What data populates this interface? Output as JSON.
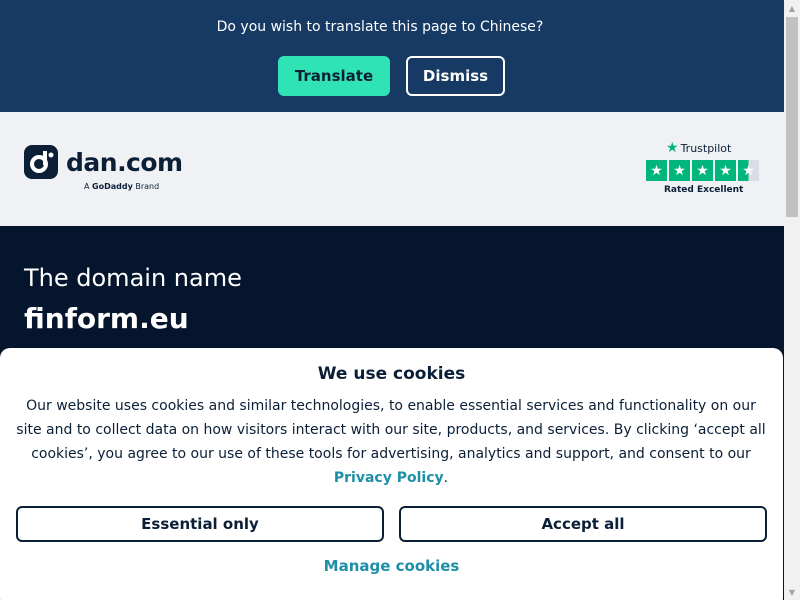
{
  "translate_bar": {
    "question": "Do you wish to translate this page to Chinese?",
    "translate_label": "Translate",
    "dismiss_label": "Dismiss"
  },
  "header": {
    "logo_text": "dan.com",
    "logo_sub_prefix": "A",
    "logo_sub_brand": "GoDaddy",
    "logo_sub_suffix": "Brand",
    "trustpilot": {
      "brand": "Trustpilot",
      "rating_text": "Rated Excellent",
      "stars": 4.5
    }
  },
  "hero": {
    "label": "The domain name",
    "domain": "finform.eu"
  },
  "cookie_dialog": {
    "title": "We use cookies",
    "body": "Our website uses cookies and similar technologies, to enable essential services and functionality on our site and to collect data on how visitors interact with our site, products, and services. By clicking ‘accept all cookies’, you agree to our use of these tools for advertising, analytics and support, and consent to our",
    "policy_link": "Privacy Policy",
    "policy_end": ".",
    "essential_label": "Essential only",
    "accept_label": "Accept all",
    "manage_label": "Manage cookies"
  },
  "colors": {
    "translate_bg": "#163a63",
    "accent_green": "#2fe3b4",
    "header_bg": "#eff1f4",
    "hero_bg": "#05152e",
    "link_teal": "#1e8fa8",
    "trustpilot_green": "#00b67a"
  }
}
